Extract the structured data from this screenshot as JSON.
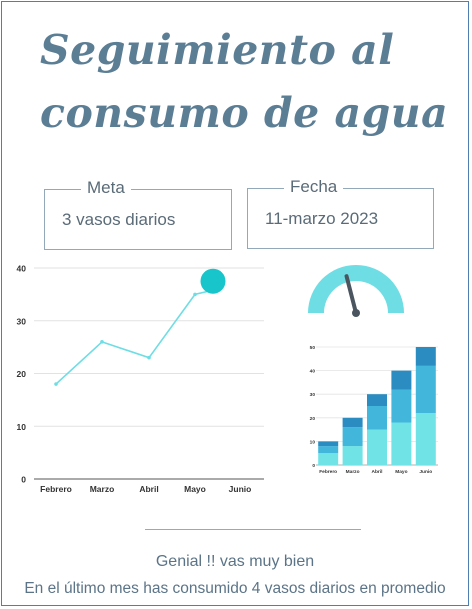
{
  "title": {
    "line1": "Seguimiento al",
    "line2": "consumo de agua"
  },
  "meta": {
    "label": "Meta",
    "value": "3 vasos diarios"
  },
  "fecha": {
    "label": "Fecha",
    "value": "11-marzo 2023"
  },
  "colors": {
    "title": "#5c7e95",
    "line": "#6fdde4",
    "marker": "#17c5cb",
    "gauge": "#6fdde4",
    "gauge_needle": "#4a5560",
    "bar_dark": "#2a8cc0",
    "bar_mid": "#43b6dc",
    "bar_light": "#6fe3e6"
  },
  "chart_data": [
    {
      "type": "line",
      "categories": [
        "Febrero",
        "Marzo",
        "Abril",
        "Mayo",
        "Junio"
      ],
      "x": [
        0,
        1,
        2,
        3,
        3.5
      ],
      "values": [
        18,
        26,
        23,
        35,
        36
      ],
      "ylim": [
        0,
        40
      ],
      "yticks": [
        0,
        10,
        20,
        30,
        40
      ],
      "grid": true,
      "highlight_x": 3.4,
      "highlight_y": 37.5
    },
    {
      "type": "gauge",
      "value": 0.42
    },
    {
      "type": "bar",
      "stacked": true,
      "categories": [
        "Febrero",
        "Marzo",
        "Abril",
        "Mayo",
        "Junio"
      ],
      "series": [
        {
          "values": [
            5,
            8,
            15,
            18,
            22
          ]
        },
        {
          "values": [
            3,
            8,
            10,
            14,
            20
          ]
        },
        {
          "values": [
            2,
            4,
            5,
            8,
            8
          ]
        }
      ],
      "ylim": [
        0,
        50
      ],
      "yticks": [
        0,
        10,
        20,
        30,
        40,
        50
      ]
    }
  ],
  "footer": {
    "line1": "Genial !! vas muy bien",
    "line2": "En el último mes has consumido 4 vasos diarios en promedio"
  }
}
